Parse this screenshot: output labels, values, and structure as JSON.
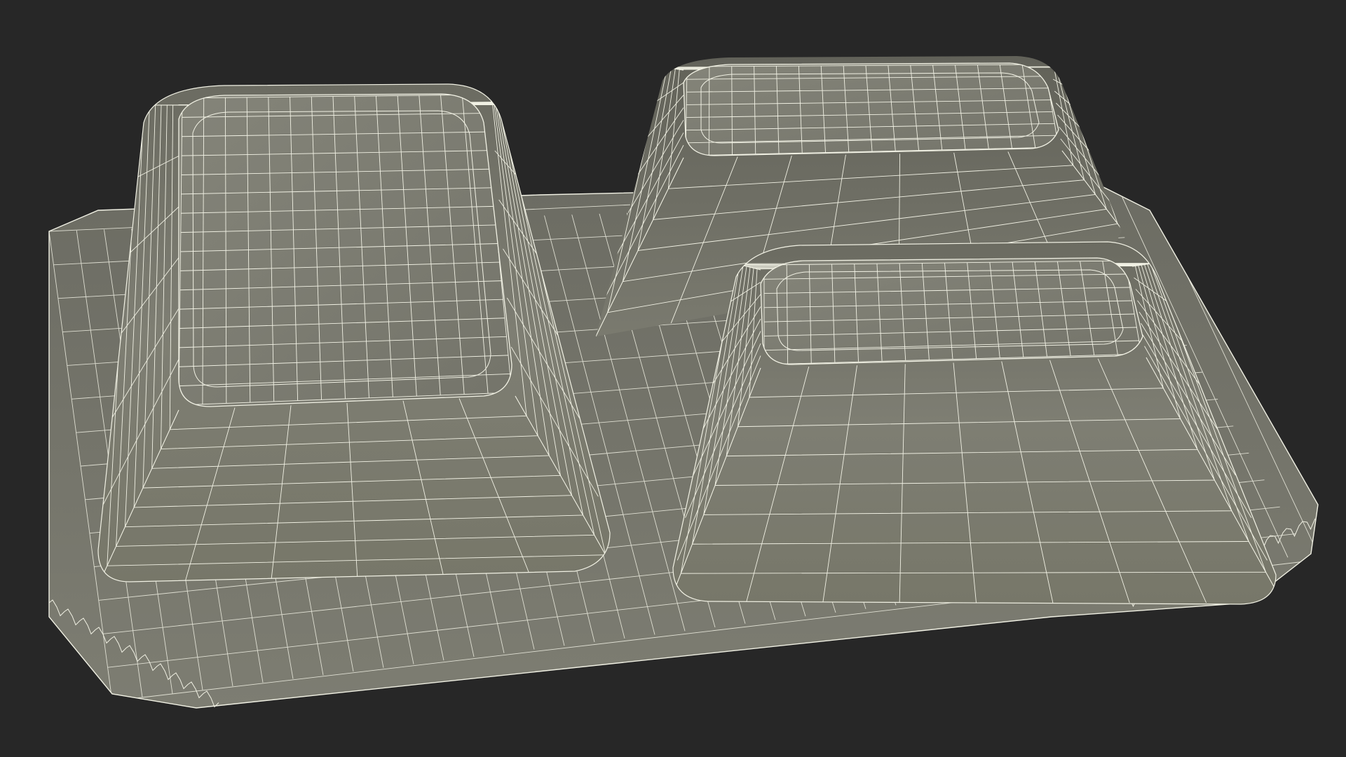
{
  "scene": {
    "subject": "three-compartment-tray-wireframe",
    "background_color": "#272727",
    "surface_color": "#7b7b70",
    "surface_highlight": "#8a8a7f",
    "surface_shadow": "#5f5f56",
    "wire_color": "#f1f1e4"
  }
}
